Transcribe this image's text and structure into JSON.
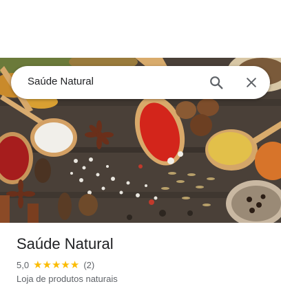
{
  "search": {
    "query": "Saúde Natural"
  },
  "icons": {
    "search": "search-icon",
    "close": "close-icon"
  },
  "place": {
    "name": "Saúde Natural",
    "rating": "5,0",
    "stars": "★★★★★",
    "rating_value": 5,
    "reviews": "(2)",
    "category": "Loja de produtos naturais"
  },
  "colors": {
    "star": "#fbbc04",
    "text": "#202124",
    "secondary": "#5f6368"
  }
}
